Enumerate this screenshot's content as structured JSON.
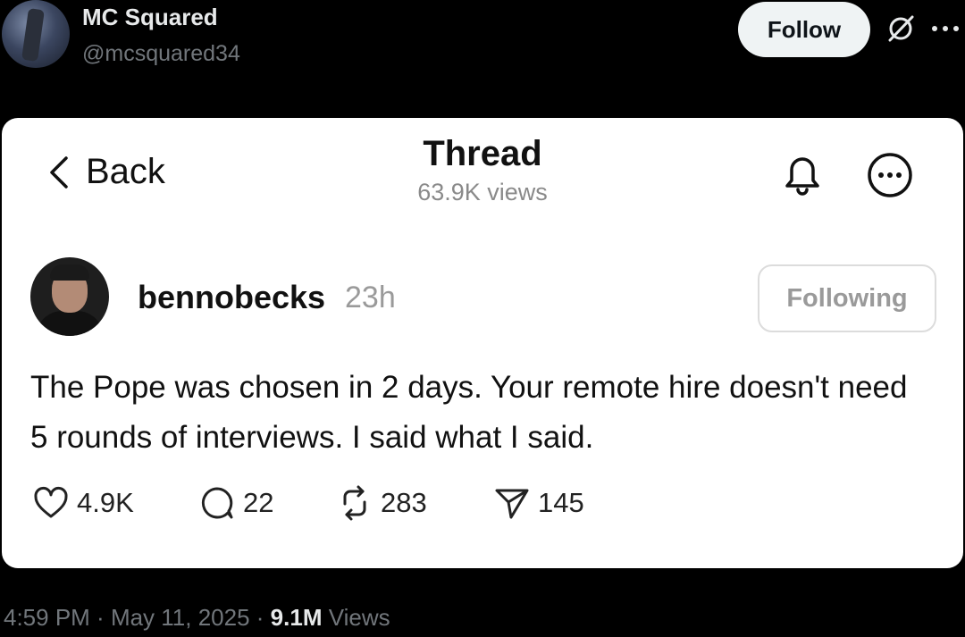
{
  "tweet": {
    "author_name": "MC Squared",
    "author_handle": "@mcsquared34",
    "follow_label": "Follow",
    "footer": {
      "time": "4:59 PM",
      "sep1": " · ",
      "date": "May 11, 2025",
      "sep2": " · ",
      "views_count": "9.1M",
      "views_label": " Views"
    }
  },
  "thread": {
    "back_label": "Back",
    "title": "Thread",
    "views": "63.9K views",
    "post": {
      "username": "bennobecks",
      "time": "23h",
      "following_label": "Following",
      "text": "The Pope was chosen in 2 days. Your remote hire doesn't need 5 rounds of interviews. I said what I said.",
      "likes": "4.9K",
      "replies": "22",
      "reposts": "283",
      "shares": "145"
    }
  },
  "icons": [
    "grok-icon",
    "more-icon",
    "chevron-left-icon",
    "bell-icon",
    "more-circle-icon",
    "heart-icon",
    "comment-icon",
    "repost-icon",
    "send-icon"
  ]
}
